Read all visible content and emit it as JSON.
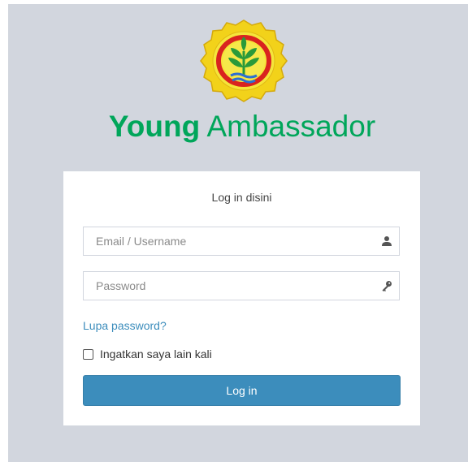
{
  "app": {
    "title_strong": "Young",
    "title_light": "Ambassador",
    "logo_icon": "ministry-of-agriculture-seal-icon",
    "accent_color": "#00a65a"
  },
  "login": {
    "heading": "Log in disini",
    "email_placeholder": "Email / Username",
    "email_value": "",
    "email_icon": "user-icon",
    "password_placeholder": "Password",
    "password_value": "",
    "password_icon": "key-icon",
    "forgot_label": "Lupa password?",
    "remember_label": "Ingatkan saya lain kali",
    "remember_checked": false,
    "submit_label": "Log in",
    "button_color": "#3c8dbc",
    "link_color": "#3c8dbc"
  }
}
